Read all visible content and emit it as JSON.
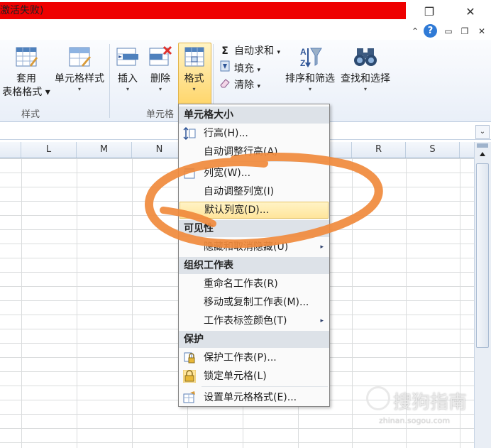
{
  "titlebar": {
    "title_fragment": "激活失败)",
    "restore_glyph": "❐",
    "close_glyph": "✕"
  },
  "ribbon_top": {
    "help_glyph": "?",
    "minimize_glyph": "▭",
    "restore_glyph": "❐",
    "close_glyph": "✕",
    "caret_glyph": "⌃"
  },
  "ribbon": {
    "styles_group": {
      "label": "样式",
      "table_format": {
        "line1": "套用",
        "line2": "表格格式",
        "arrow": "▾"
      },
      "cell_styles": {
        "label": "单元格样式",
        "arrow": "▾"
      }
    },
    "cells_group": {
      "label": "单元格",
      "insert": {
        "label": "插入",
        "arrow": "▾"
      },
      "delete": {
        "label": "删除",
        "arrow": "▾"
      },
      "format": {
        "label": "格式",
        "arrow": "▾"
      }
    },
    "editing_group": {
      "autosum": {
        "icon": "Σ",
        "label": "自动求和",
        "arrow": "▾"
      },
      "fill": {
        "label": "填充",
        "arrow": "▾"
      },
      "clear": {
        "label": "清除",
        "arrow": "▾"
      },
      "sort_filter": {
        "label": "排序和筛选",
        "arrow": "▾"
      },
      "find_select": {
        "label": "查找和选择",
        "arrow": "▾"
      }
    }
  },
  "formula_bar": {
    "expand_glyph": "⌄"
  },
  "columns": [
    "L",
    "M",
    "N",
    "R",
    "S"
  ],
  "menu": {
    "cell_size_header": "单元格大小",
    "row_height": "行高(H)...",
    "autofit_row_height": "自动调整行高(A)",
    "column_width": "列宽(W)...",
    "autofit_column_width": "自动调整列宽(I)",
    "default_width": "默认列宽(D)...",
    "visibility_header": "可见性",
    "hide_unhide": "隐藏和取消隐藏(U)",
    "organize_header": "组织工作表",
    "rename_sheet": "重命名工作表(R)",
    "move_copy_sheet": "移动或复制工作表(M)...",
    "tab_color": "工作表标签颜色(T)",
    "protection_header": "保护",
    "protect_sheet": "保护工作表(P)...",
    "lock_cell": "锁定单元格(L)",
    "format_cells": "设置单元格格式(E)...",
    "submenu_glyph": "▸"
  },
  "watermark": {
    "text": "搜狗指南",
    "sub": "zhinan.sogou.com"
  },
  "colors": {
    "title_red": "#ee0000",
    "highlight": "#ffe59b",
    "annotation_orange": "#f08a3c"
  }
}
